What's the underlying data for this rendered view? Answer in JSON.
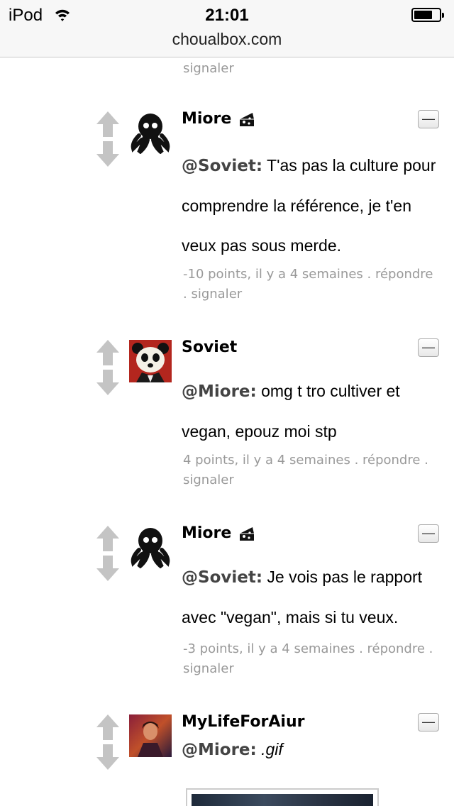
{
  "status": {
    "carrier": "iPod",
    "time": "21:01"
  },
  "browser": {
    "url": "choualbox.com"
  },
  "top_meta": {
    "report": "signaler"
  },
  "comments": [
    {
      "user": "Miore",
      "has_badge": true,
      "avatar": "octopus-avatar",
      "collapse_label": "—",
      "mention": "@Soviet:",
      "text": " T'as pas la culture pour comprendre la référence, je t'en veux pas sous merde.",
      "points": "-10 points,",
      "age": "il y a 4 semaines",
      "reply": ". répondre",
      "report": ". signaler"
    },
    {
      "user": "Soviet",
      "has_badge": false,
      "avatar": "panda-avatar",
      "collapse_label": "—",
      "mention": "@Miore:",
      "text": " omg t tro cultiver et vegan, epouz moi stp",
      "points": "4 points,",
      "age": "il y a 4 semaines",
      "reply": ". répondre .",
      "report": "signaler"
    },
    {
      "user": "Miore",
      "has_badge": true,
      "avatar": "octopus-avatar",
      "collapse_label": "—",
      "mention": "@Soviet:",
      "text": " Je vois pas le rapport avec \"vegan\", mais si tu veux.",
      "points": "-3 points,",
      "age": "il y a 4 semaines",
      "reply": ". répondre .",
      "report": "signaler"
    },
    {
      "user": "MyLifeForAiur",
      "has_badge": false,
      "avatar": "portrait-avatar",
      "collapse_label": "—",
      "mention": "@Miore:",
      "text": ".gif"
    }
  ],
  "icons": {
    "vote_arrows": "up-down-arrows-icon",
    "badge": "cheese-icon",
    "wifi": "wifi-icon",
    "battery": "battery-icon"
  },
  "colors": {
    "meta_text": "#999999",
    "mention": "#444444",
    "vote_arrow": "#c4c4c4"
  }
}
